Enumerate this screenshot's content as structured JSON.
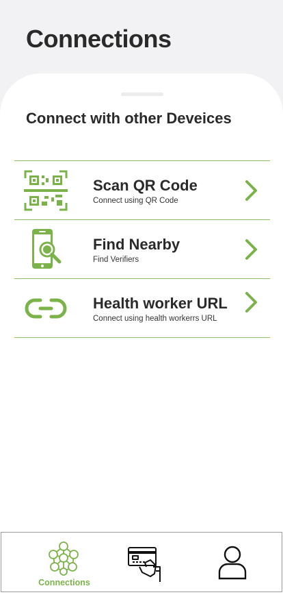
{
  "header": {
    "title": "Connections"
  },
  "sheet": {
    "section_title": "Connect with other Deveices",
    "items": [
      {
        "icon": "qr-code-icon",
        "title": "Scan QR Code",
        "subtitle": "Connect using QR Code"
      },
      {
        "icon": "find-nearby-icon",
        "title": "Find Nearby",
        "subtitle": "Find Verifiers"
      },
      {
        "icon": "link-icon",
        "title": "Health worker URL",
        "subtitle": "Connect using health workerrs URL"
      }
    ]
  },
  "tabbar": {
    "tabs": [
      {
        "icon": "network-icon",
        "label": "Connections",
        "active": true
      },
      {
        "icon": "card-hand-icon",
        "label": "",
        "active": false
      },
      {
        "icon": "profile-icon",
        "label": "",
        "active": false
      }
    ]
  },
  "colors": {
    "accent": "#7bb34a",
    "divider": "#8cc068",
    "title": "#2a2a2a"
  }
}
